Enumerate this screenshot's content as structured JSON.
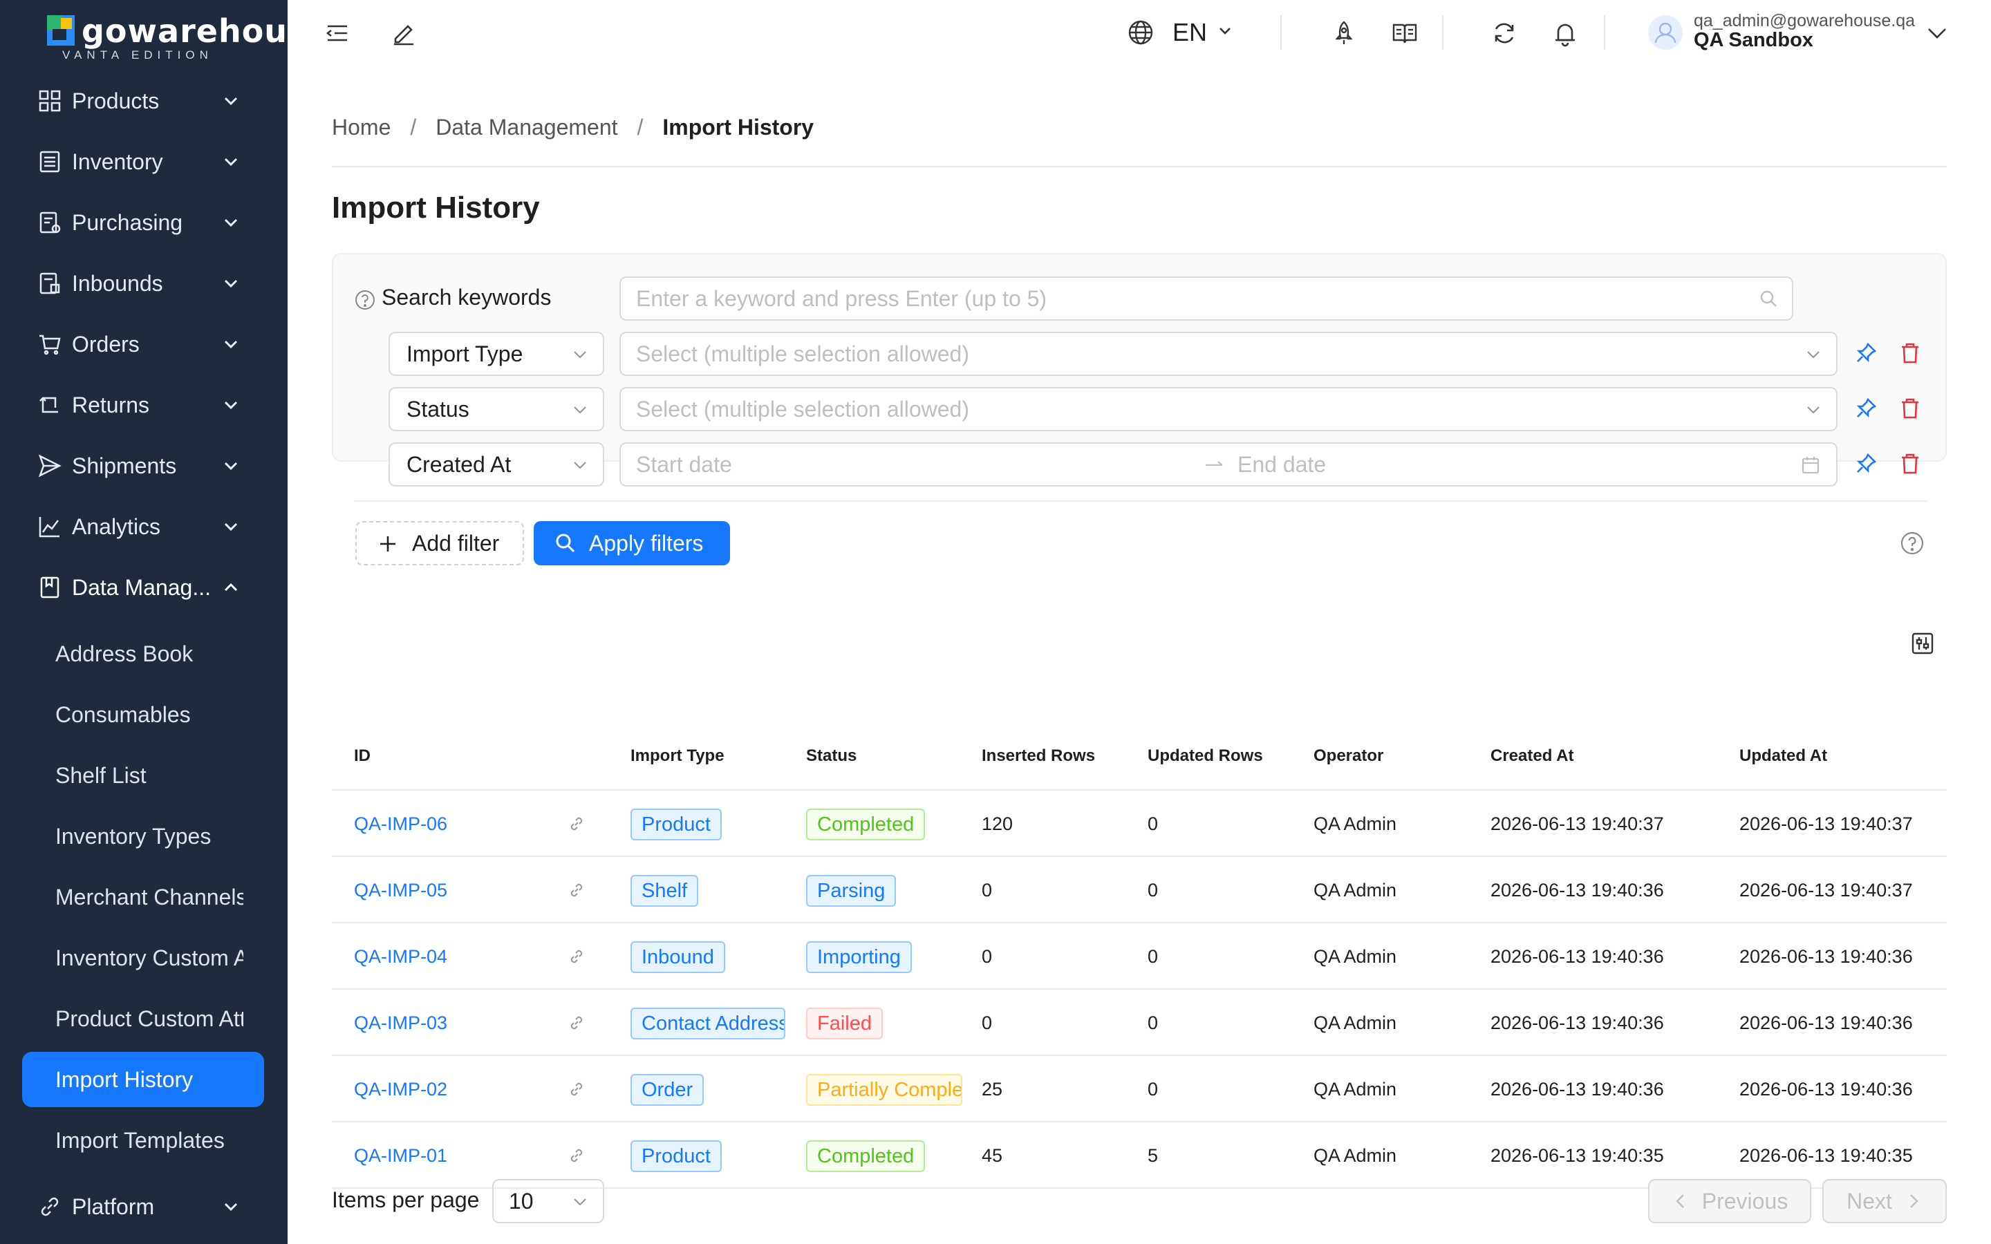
{
  "brand": {
    "name": "gowarehouse",
    "edition": "VANTA EDITION"
  },
  "sidebar": {
    "items": [
      {
        "label": "Products",
        "icon": "grid-icon"
      },
      {
        "label": "Inventory",
        "icon": "list-icon"
      },
      {
        "label": "Purchasing",
        "icon": "purchase-icon"
      },
      {
        "label": "Inbounds",
        "icon": "inbound-icon"
      },
      {
        "label": "Orders",
        "icon": "cart-icon"
      },
      {
        "label": "Returns",
        "icon": "return-icon"
      },
      {
        "label": "Shipments",
        "icon": "send-icon"
      },
      {
        "label": "Analytics",
        "icon": "chart-line-icon"
      },
      {
        "label": "Data Manag...",
        "icon": "book-icon"
      }
    ],
    "data_management_children": [
      "Address Book",
      "Consumables",
      "Shelf List",
      "Inventory Types",
      "Merchant Channels",
      "Inventory Custom Attributes",
      "Product Custom Attributes",
      "Import History",
      "Import Templates"
    ],
    "active_item": "Import History",
    "platform": {
      "label": "Platform",
      "icon": "link-icon"
    }
  },
  "header": {
    "language": "EN",
    "user_email": "qa_admin@gowarehouse.qa",
    "org": "QA Sandbox"
  },
  "breadcrumb": [
    "Home",
    "Data Management",
    "Import History"
  ],
  "page_title": "Import History",
  "filters": {
    "search_label": "Search keywords",
    "search_placeholder": "Enter a keyword and press Enter (up to 5)",
    "rows": [
      {
        "field": "Import Type",
        "placeholder": "Select (multiple selection allowed)"
      },
      {
        "field": "Status",
        "placeholder": "Select (multiple selection allowed)"
      },
      {
        "field": "Created At",
        "start_placeholder": "Start date",
        "end_placeholder": "End date"
      }
    ],
    "add_filter_label": "Add filter",
    "apply_label": "Apply filters"
  },
  "table": {
    "columns": [
      "ID",
      "Import Type",
      "Status",
      "Inserted Rows",
      "Updated Rows",
      "Operator",
      "Created At",
      "Updated At"
    ],
    "rows": [
      {
        "id": "QA-IMP-06",
        "type": "Product",
        "status": "Completed",
        "status_kind": "success",
        "inserted": "120",
        "updated": "0",
        "operator": "QA Admin",
        "created": "2026-06-13 19:40:37",
        "updated_at": "2026-06-13 19:40:37"
      },
      {
        "id": "QA-IMP-05",
        "type": "Shelf",
        "status": "Parsing",
        "status_kind": "processing",
        "inserted": "0",
        "updated": "0",
        "operator": "QA Admin",
        "created": "2026-06-13 19:40:36",
        "updated_at": "2026-06-13 19:40:37"
      },
      {
        "id": "QA-IMP-04",
        "type": "Inbound",
        "status": "Importing",
        "status_kind": "processing",
        "inserted": "0",
        "updated": "0",
        "operator": "QA Admin",
        "created": "2026-06-13 19:40:36",
        "updated_at": "2026-06-13 19:40:36"
      },
      {
        "id": "QA-IMP-03",
        "type": "Contact Address",
        "status": "Failed",
        "status_kind": "error",
        "inserted": "0",
        "updated": "0",
        "operator": "QA Admin",
        "created": "2026-06-13 19:40:36",
        "updated_at": "2026-06-13 19:40:36"
      },
      {
        "id": "QA-IMP-02",
        "type": "Order",
        "status": "Partially Completed",
        "status_kind": "warning",
        "inserted": "25",
        "updated": "0",
        "operator": "QA Admin",
        "created": "2026-06-13 19:40:36",
        "updated_at": "2026-06-13 19:40:36"
      },
      {
        "id": "QA-IMP-01",
        "type": "Product",
        "status": "Completed",
        "status_kind": "success",
        "inserted": "45",
        "updated": "5",
        "operator": "QA Admin",
        "created": "2026-06-13 19:40:35",
        "updated_at": "2026-06-13 19:40:35"
      }
    ]
  },
  "pagination": {
    "items_per_page_label": "Items per page",
    "page_size": "10",
    "previous_label": "Previous",
    "next_label": "Next"
  },
  "colors": {
    "sidebar_bg": "#1f2a3d",
    "accent": "#1677ff",
    "success": "#52c41a",
    "error": "#ff4d4f",
    "warning": "#faad14",
    "danger_icon": "#e5343b"
  }
}
